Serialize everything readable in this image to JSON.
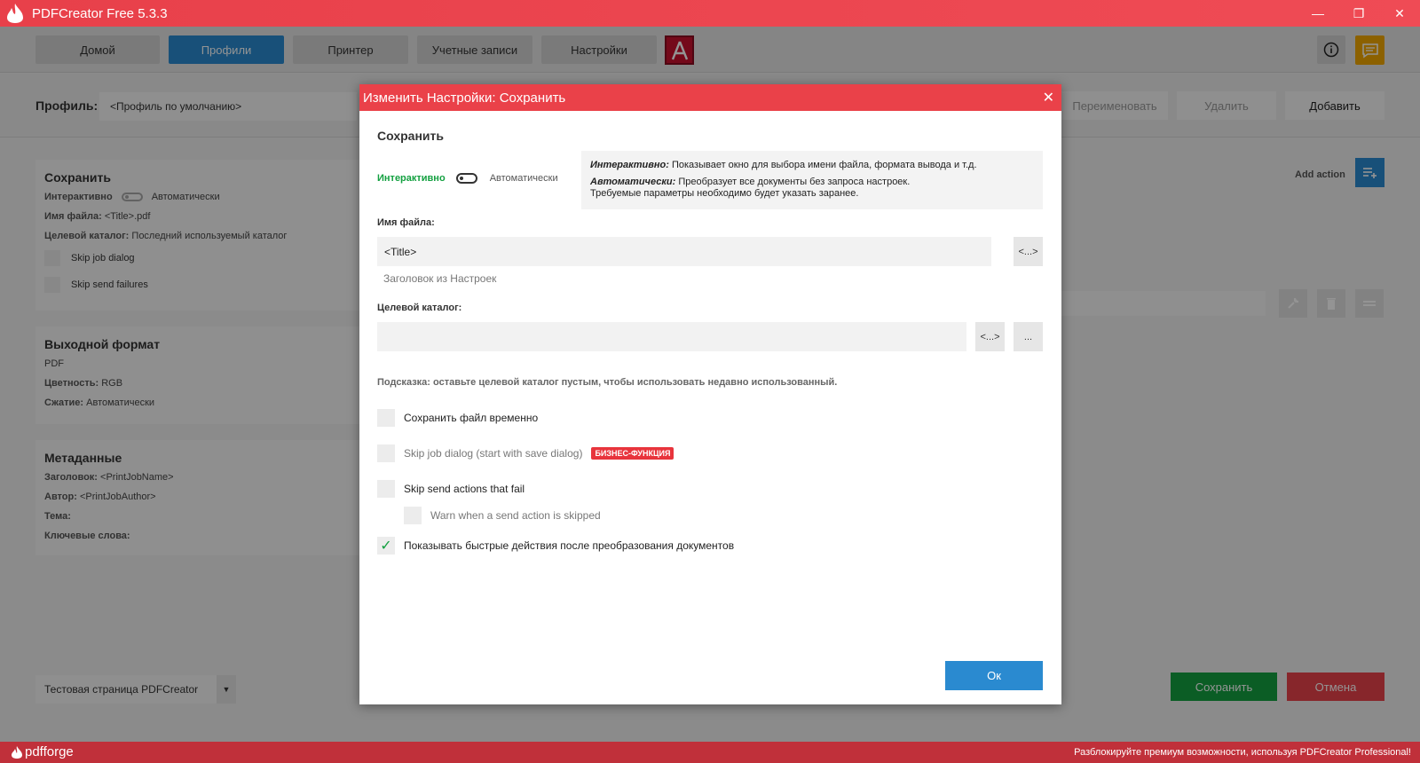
{
  "window": {
    "title": "PDFCreator Free 5.3.3",
    "minimize": "—",
    "maximize": "❐",
    "close": "✕"
  },
  "nav": {
    "home": "Домой",
    "profiles": "Профили",
    "printer": "Принтер",
    "accounts": "Учетные записи",
    "settings": "Настройки"
  },
  "profile": {
    "label": "Профиль:",
    "selected": "<Профиль по умолчанию>",
    "rename": "Переименовать",
    "delete": "Удалить",
    "add": "Добавить"
  },
  "save_card": {
    "title": "Сохранить",
    "mode_interactive": "Интерактивно",
    "mode_auto": "Автоматически",
    "filename_label": "Имя файла:",
    "filename_value": "<Title>.pdf",
    "dir_label": "Целевой каталог:",
    "dir_value": "Последний используемый каталог",
    "skip_job": "Skip job dialog",
    "skip_send": "Skip send failures"
  },
  "output_card": {
    "title": "Выходной формат",
    "format": "PDF",
    "color_label": "Цветность:",
    "color_value": "RGB",
    "compress_label": "Сжатие:",
    "compress_value": "Автоматически"
  },
  "meta_card": {
    "title": "Метаданные",
    "title_label": "Заголовок:",
    "title_value": "<PrintJobName>",
    "author_label": "Автор:",
    "author_value": "<PrintJobAuthor>",
    "subject_label": "Тема:",
    "keywords_label": "Ключевые слова:"
  },
  "actions": {
    "add_action": "Add action"
  },
  "footer": {
    "testpage": "Тестовая страница PDFCreator",
    "save": "Сохранить",
    "cancel": "Отмена"
  },
  "bottombar": {
    "brand": "pdfforge",
    "promo": "Разблокируйте премиум возможности, используя PDFCreator Professional!"
  },
  "dialog": {
    "title": "Изменить Настройки: Сохранить",
    "close": "✕",
    "heading": "Сохранить",
    "mode_interactive": "Интерактивно",
    "mode_auto": "Автоматически",
    "info_inter_label": "Интерактивно:",
    "info_inter_text": " Показывает окно для выбора имени файла, формата вывода и т.д.",
    "info_auto_label": "Автоматически:",
    "info_auto_text": " Преобразует все документы без запроса настроек.",
    "info_auto_text2": "Требуемые параметры необходимо будет указать заранее.",
    "filename_label": "Имя файла:",
    "filename_value": "<Title>",
    "token_btn": "<...>",
    "filename_hint": "Заголовок из Настроек",
    "dir_label": "Целевой каталог:",
    "dir_value": "",
    "browse_btn": "...",
    "tip": "Подсказка: оставьте целевой каталог пустым, чтобы использовать недавно использованный.",
    "save_temp": "Сохранить файл временно",
    "skip_job": "Skip job dialog (start with save dialog)",
    "business_badge": "БИЗНЕС-ФУНКЦИЯ",
    "skip_send": "Skip send actions that fail",
    "warn_skip": "Warn when a send action is skipped",
    "quick_actions": "Показывать быстрые действия после преобразования документов",
    "quick_actions_checked": "✓",
    "ok": "Ок"
  },
  "colors": {
    "accent_red": "#ea4149",
    "accent_blue": "#2a8ad0",
    "green": "#13a040",
    "yellow": "#f2a800"
  }
}
